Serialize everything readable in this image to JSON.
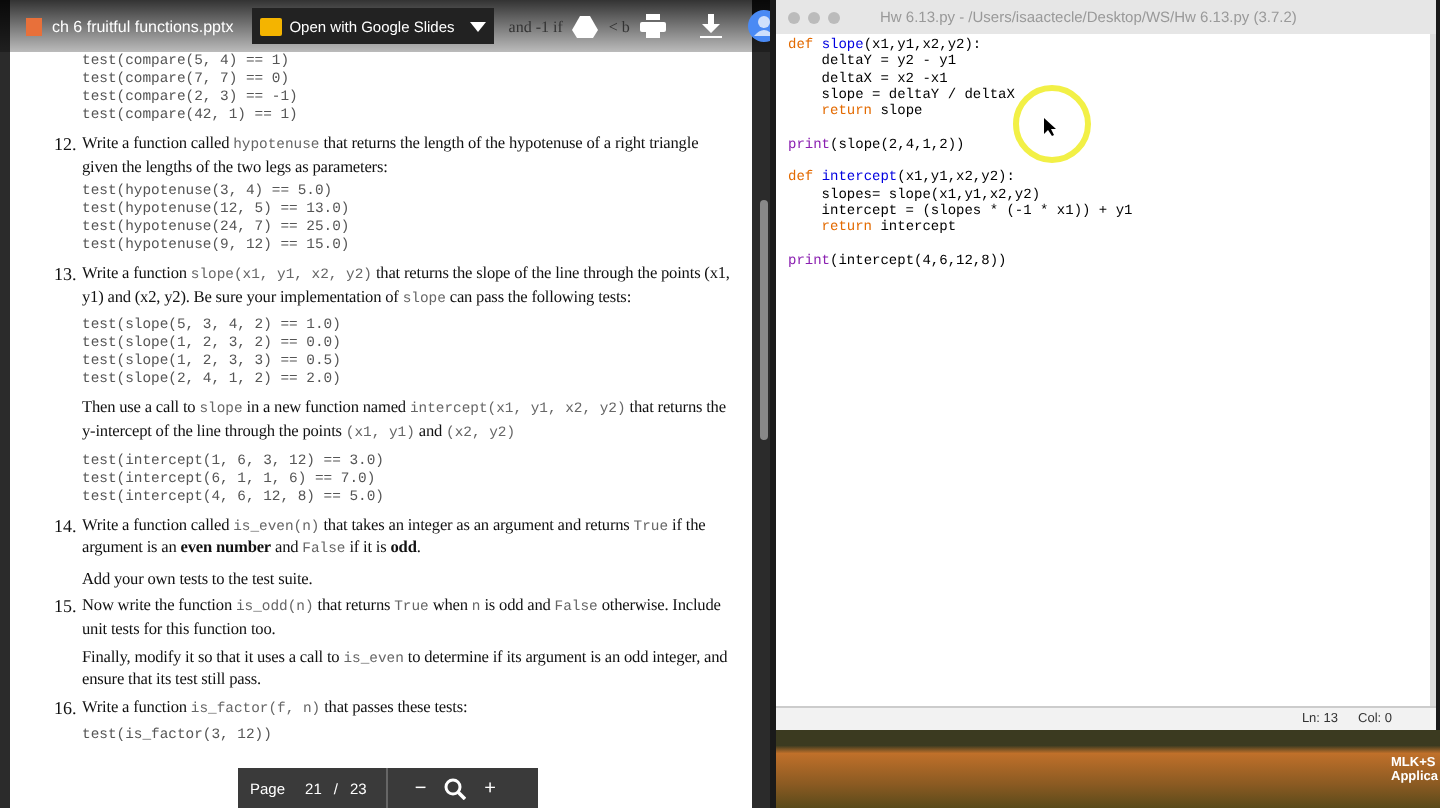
{
  "viewer": {
    "file_name": "ch 6 fruitful functions.pptx",
    "open_button": "Open with Google Slides",
    "hidden_line_fragments": [
      "and -1 if",
      "< b"
    ],
    "page_label": "Page",
    "page_current": "21",
    "page_separator": "/",
    "page_total": "23",
    "zoom_out": "−",
    "zoom_in": "+"
  },
  "document": {
    "blocks": [
      {
        "kind": "tests",
        "lines": [
          "test(compare(5, 4) == 1)",
          "test(compare(7, 7) == 0)",
          "test(compare(2, 3) == -1)",
          "test(compare(42, 1) == 1)"
        ]
      },
      {
        "kind": "item",
        "number": "12.",
        "segments": [
          {
            "kind": "plain",
            "text": "Write a function called "
          },
          {
            "kind": "code",
            "text": "hypotenuse"
          },
          {
            "kind": "plain",
            "text": " that returns the length of the hypotenuse of a right triangle given the lengths of the two legs as parameters:"
          }
        ]
      },
      {
        "kind": "tests",
        "lines": [
          "test(hypotenuse(3, 4) == 5.0)",
          "test(hypotenuse(12, 5) == 13.0)",
          "test(hypotenuse(24, 7) == 25.0)",
          "test(hypotenuse(9, 12) == 15.0)"
        ]
      },
      {
        "kind": "item",
        "number": "13.",
        "segments": [
          {
            "kind": "plain",
            "text": "Write a function "
          },
          {
            "kind": "code",
            "text": "slope(x1, y1, x2, y2)"
          },
          {
            "kind": "plain",
            "text": " that returns the slope of the line through the points (x1, y1) and (x2, y2). Be sure your implementation of "
          },
          {
            "kind": "code",
            "text": "slope"
          },
          {
            "kind": "plain",
            "text": " can pass the following tests:"
          }
        ]
      },
      {
        "kind": "tests",
        "lines": [
          "test(slope(5, 3, 4, 2) == 1.0)",
          "test(slope(1, 2, 3, 2) == 0.0)",
          "test(slope(1, 2, 3, 3) == 0.5)",
          "test(slope(2, 4, 1, 2) == 2.0)"
        ]
      },
      {
        "kind": "para",
        "segments": [
          {
            "kind": "plain",
            "text": "Then use a call to "
          },
          {
            "kind": "code",
            "text": "slope"
          },
          {
            "kind": "plain",
            "text": " in a new function named "
          },
          {
            "kind": "code",
            "text": "intercept(x1, y1, x2, y2)"
          },
          {
            "kind": "plain",
            "text": " that returns the y-intercept of the line through the points "
          },
          {
            "kind": "code",
            "text": "(x1, y1)"
          },
          {
            "kind": "plain",
            "text": " and "
          },
          {
            "kind": "code",
            "text": "(x2, y2)"
          }
        ]
      },
      {
        "kind": "tests",
        "lines": [
          "test(intercept(1, 6, 3, 12) == 3.0)",
          "test(intercept(6, 1, 1, 6) == 7.0)",
          "test(intercept(4, 6, 12, 8) == 5.0)"
        ]
      },
      {
        "kind": "item",
        "number": "14.",
        "segments": [
          {
            "kind": "plain",
            "text": "Write a function called "
          },
          {
            "kind": "code",
            "text": "is_even(n)"
          },
          {
            "kind": "plain",
            "text": " that takes an integer as an argument and returns "
          },
          {
            "kind": "code",
            "text": "True"
          },
          {
            "kind": "plain",
            "text": " if the argument is an "
          },
          {
            "kind": "bold",
            "text": "even number"
          },
          {
            "kind": "plain",
            "text": " and "
          },
          {
            "kind": "code",
            "text": "False"
          },
          {
            "kind": "plain",
            "text": " if it is "
          },
          {
            "kind": "bold",
            "text": "odd"
          },
          {
            "kind": "plain",
            "text": "."
          }
        ]
      },
      {
        "kind": "para",
        "segments": [
          {
            "kind": "plain",
            "text": "Add your own tests to the test suite."
          }
        ]
      },
      {
        "kind": "item",
        "number": "15.",
        "segments": [
          {
            "kind": "plain",
            "text": "Now write the function "
          },
          {
            "kind": "code",
            "text": "is_odd(n)"
          },
          {
            "kind": "plain",
            "text": " that returns "
          },
          {
            "kind": "code",
            "text": "True"
          },
          {
            "kind": "plain",
            "text": " when "
          },
          {
            "kind": "code",
            "text": "n"
          },
          {
            "kind": "plain",
            "text": " is odd and "
          },
          {
            "kind": "code",
            "text": "False"
          },
          {
            "kind": "plain",
            "text": " otherwise. Include unit tests for this function too."
          }
        ]
      },
      {
        "kind": "para",
        "segments": [
          {
            "kind": "plain",
            "text": "Finally, modify it so that it uses a call to "
          },
          {
            "kind": "code",
            "text": "is_even"
          },
          {
            "kind": "plain",
            "text": " to determine if its argument is an odd integer, and ensure that its test still pass."
          }
        ]
      },
      {
        "kind": "item",
        "number": "16.",
        "segments": [
          {
            "kind": "plain",
            "text": "Write a function "
          },
          {
            "kind": "code",
            "text": "is_factor(f, n)"
          },
          {
            "kind": "plain",
            "text": " that passes these tests:"
          }
        ]
      },
      {
        "kind": "tests",
        "lines": [
          "test(is_factor(3, 12))"
        ]
      }
    ]
  },
  "editor": {
    "title": "Hw 6.13.py - /Users/isaactecle/Desktop/WS/Hw 6.13.py (3.7.2)",
    "code_blocks": [
      [
        [
          {
            "kind": "kw",
            "text": "def "
          },
          {
            "kind": "fn",
            "text": "slope"
          },
          {
            "kind": "plain",
            "text": "(x1,y1,x2,y2):"
          }
        ],
        [
          {
            "kind": "plain",
            "text": "    deltaY = y2 - y1"
          }
        ],
        [
          {
            "kind": "plain",
            "text": "    deltaX = x2 -x1"
          }
        ],
        [
          {
            "kind": "plain",
            "text": "    slope = deltaY / deltaX"
          }
        ],
        [
          {
            "kind": "kw",
            "text": "    return"
          },
          {
            "kind": "plain",
            "text": " slope"
          }
        ]
      ],
      [
        [
          {
            "kind": "builtin",
            "text": "print"
          },
          {
            "kind": "plain",
            "text": "(slope(2,4,1,2))"
          }
        ]
      ],
      [
        [
          {
            "kind": "kw",
            "text": "def "
          },
          {
            "kind": "fn",
            "text": "intercept"
          },
          {
            "kind": "plain",
            "text": "(x1,y1,x2,y2):"
          }
        ],
        [
          {
            "kind": "plain",
            "text": "    slopes= slope(x1,y1,x2,y2)"
          }
        ],
        [
          {
            "kind": "plain",
            "text": "    intercept = (slopes * (-1 * x1)) + y1"
          }
        ],
        [
          {
            "kind": "kw",
            "text": "    return"
          },
          {
            "kind": "plain",
            "text": " intercept"
          }
        ]
      ],
      [
        [
          {
            "kind": "builtin",
            "text": "print"
          },
          {
            "kind": "plain",
            "text": "(intercept(4,6,12,8))"
          }
        ]
      ]
    ],
    "line_label": "Ln: 13",
    "col_label": "Col: 0"
  },
  "desktop": {
    "icon_label_lines": [
      "MLK+S",
      "Applica"
    ]
  }
}
